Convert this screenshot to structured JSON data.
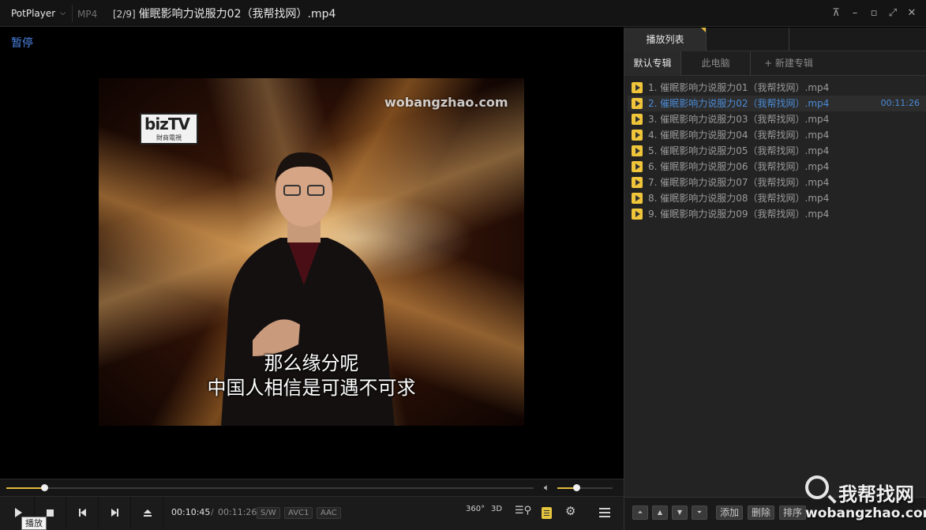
{
  "titlebar": {
    "app_name": "PotPlayer",
    "format": "MP4",
    "index": "[2/9]",
    "file_title": "催眠影响力说服力02（我帮找网）.mp4",
    "buttons": {
      "pin": "pin-icon",
      "minimize": "minimize-icon",
      "maximize": "maximize-icon",
      "fullscreen": "fullscreen-icon",
      "close": "close-icon"
    }
  },
  "video": {
    "osd_status": "暂停",
    "frame_watermark": "wobangzhao.com",
    "logo_text": "bizTV",
    "logo_subtext": "財商電視",
    "subtitle_line1": "那么缘分呢",
    "subtitle_line2": "中国人相信是可遇不可求"
  },
  "seek": {
    "progress": 0.072,
    "volume": 0.34
  },
  "controls": {
    "tooltip": "播放",
    "time_current": "00:10:45",
    "time_separator": "/",
    "time_total": "00:11:26",
    "tags": [
      "S/W",
      "AVC1",
      "AAC"
    ],
    "icon_360": "360°",
    "icon_3d": "3D"
  },
  "panel": {
    "tab_playlist": "播放列表",
    "album_tabs": [
      "默认专辑",
      "此电脑",
      "+ 新建专辑"
    ],
    "items": [
      {
        "label": "1. 催眠影响力说服力01（我帮找网）.mp4",
        "duration": ""
      },
      {
        "label": "2. 催眠影响力说服力02（我帮找网）.mp4",
        "duration": "00:11:26"
      },
      {
        "label": "3. 催眠影响力说服力03（我帮找网）.mp4",
        "duration": ""
      },
      {
        "label": "4. 催眠影响力说服力04（我帮找网）.mp4",
        "duration": ""
      },
      {
        "label": "5. 催眠影响力说服力05（我帮找网）.mp4",
        "duration": ""
      },
      {
        "label": "6. 催眠影响力说服力06（我帮找网）.mp4",
        "duration": ""
      },
      {
        "label": "7. 催眠影响力说服力07（我帮找网）.mp4",
        "duration": ""
      },
      {
        "label": "8. 催眠影响力说服力08（我帮找网）.mp4",
        "duration": ""
      },
      {
        "label": "9. 催眠影响力说服力09（我帮找网）.mp4",
        "duration": ""
      }
    ],
    "footer": {
      "add": "添加",
      "delete": "删除",
      "sort": "排序"
    }
  },
  "overlay_watermark": {
    "cn": "我帮找网",
    "url": "wobangzhao.com"
  },
  "colors": {
    "accent": "#e0b93a",
    "active_item": "#4b8bd6",
    "osd": "#4c83e3"
  }
}
